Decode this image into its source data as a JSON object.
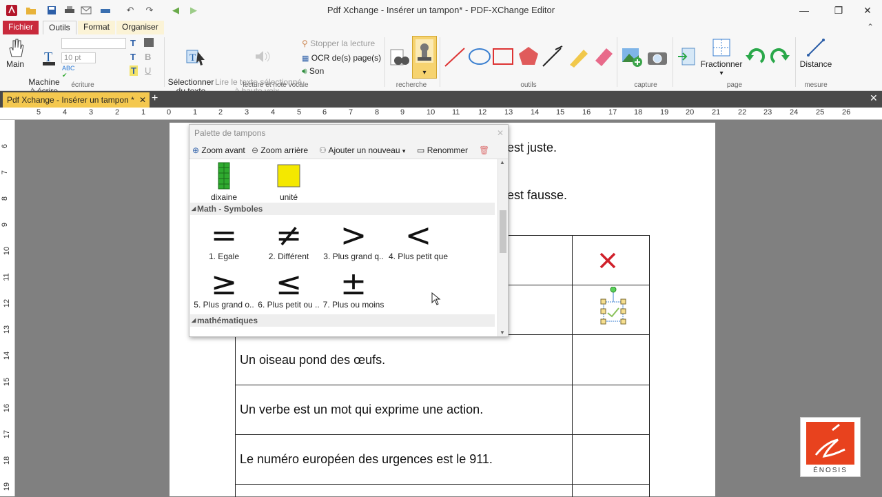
{
  "window": {
    "title": "Pdf Xchange - Insérer un tampon* - PDF-XChange Editor"
  },
  "menu": {
    "tabs": [
      "Fichier",
      "Outils",
      "Format",
      "Organiser"
    ]
  },
  "ribbon": {
    "hand": "Main",
    "typewriter": "Machine\nà écrire",
    "font_size": "10 pt",
    "group_ecriture": "écriture",
    "select_text": "Sélectionner\ndu texte",
    "read_aloud": "Lire le texte sélectionné\nà haute voix",
    "stop_reading": "Stopper la lecture",
    "ocr": "OCR de(s) page(s)",
    "sound": "Son",
    "group_lecture": "lecture et note vocale",
    "group_recherche": "recherche",
    "group_outils": "outils",
    "group_capture": "capture",
    "split": "Fractionner",
    "group_page": "page",
    "distance": "Distance",
    "group_mesure": "mesure"
  },
  "doctab": {
    "label": "Pdf Xchange - Insérer un tampon *"
  },
  "rulers": {
    "h": [
      "5",
      "4",
      "3",
      "2",
      "1",
      "0",
      "1",
      "2",
      "3",
      "4",
      "5",
      "6",
      "7",
      "8",
      "9",
      "10",
      "11",
      "12",
      "13",
      "14",
      "15",
      "16",
      "17",
      "18",
      "19",
      "20",
      "21",
      "22",
      "23",
      "24",
      "25",
      "26"
    ],
    "v": [
      "6",
      "7",
      "8",
      "9",
      "10",
      "11",
      "12",
      "13",
      "14",
      "15",
      "16",
      "17",
      "18",
      "19"
    ]
  },
  "document": {
    "row1_tail": "est juste.",
    "row2_tail": "est fausse.",
    "row3": "Un oiseau pond des œufs.",
    "row4": "Un verbe est un mot qui exprime une action.",
    "row5": "Le numéro européen des urgences est le 911."
  },
  "palette": {
    "title": "Palette de tampons",
    "zoom_in": "Zoom avant",
    "zoom_out": "Zoom arrière",
    "add_new": "Ajouter un nouveau",
    "rename": "Renommer",
    "items_top": [
      "dixaine",
      "unité"
    ],
    "section_symbols": "Math - Symboles",
    "symbols": [
      {
        "sym": "=",
        "label": "1. Egale"
      },
      {
        "sym": "≠",
        "label": "2. Différent"
      },
      {
        "sym": ">",
        "label": "3. Plus grand q.."
      },
      {
        "sym": "<",
        "label": "4. Plus petit que"
      },
      {
        "sym": "≥",
        "label": "5. Plus grand o.."
      },
      {
        "sym": "≤",
        "label": "6. Plus petit ou .."
      },
      {
        "sym": "±",
        "label": "7. Plus ou moins"
      }
    ],
    "section_math": "mathématiques"
  },
  "logo": {
    "text": "ÉNOSIS",
    "accent": "#e8421e"
  }
}
